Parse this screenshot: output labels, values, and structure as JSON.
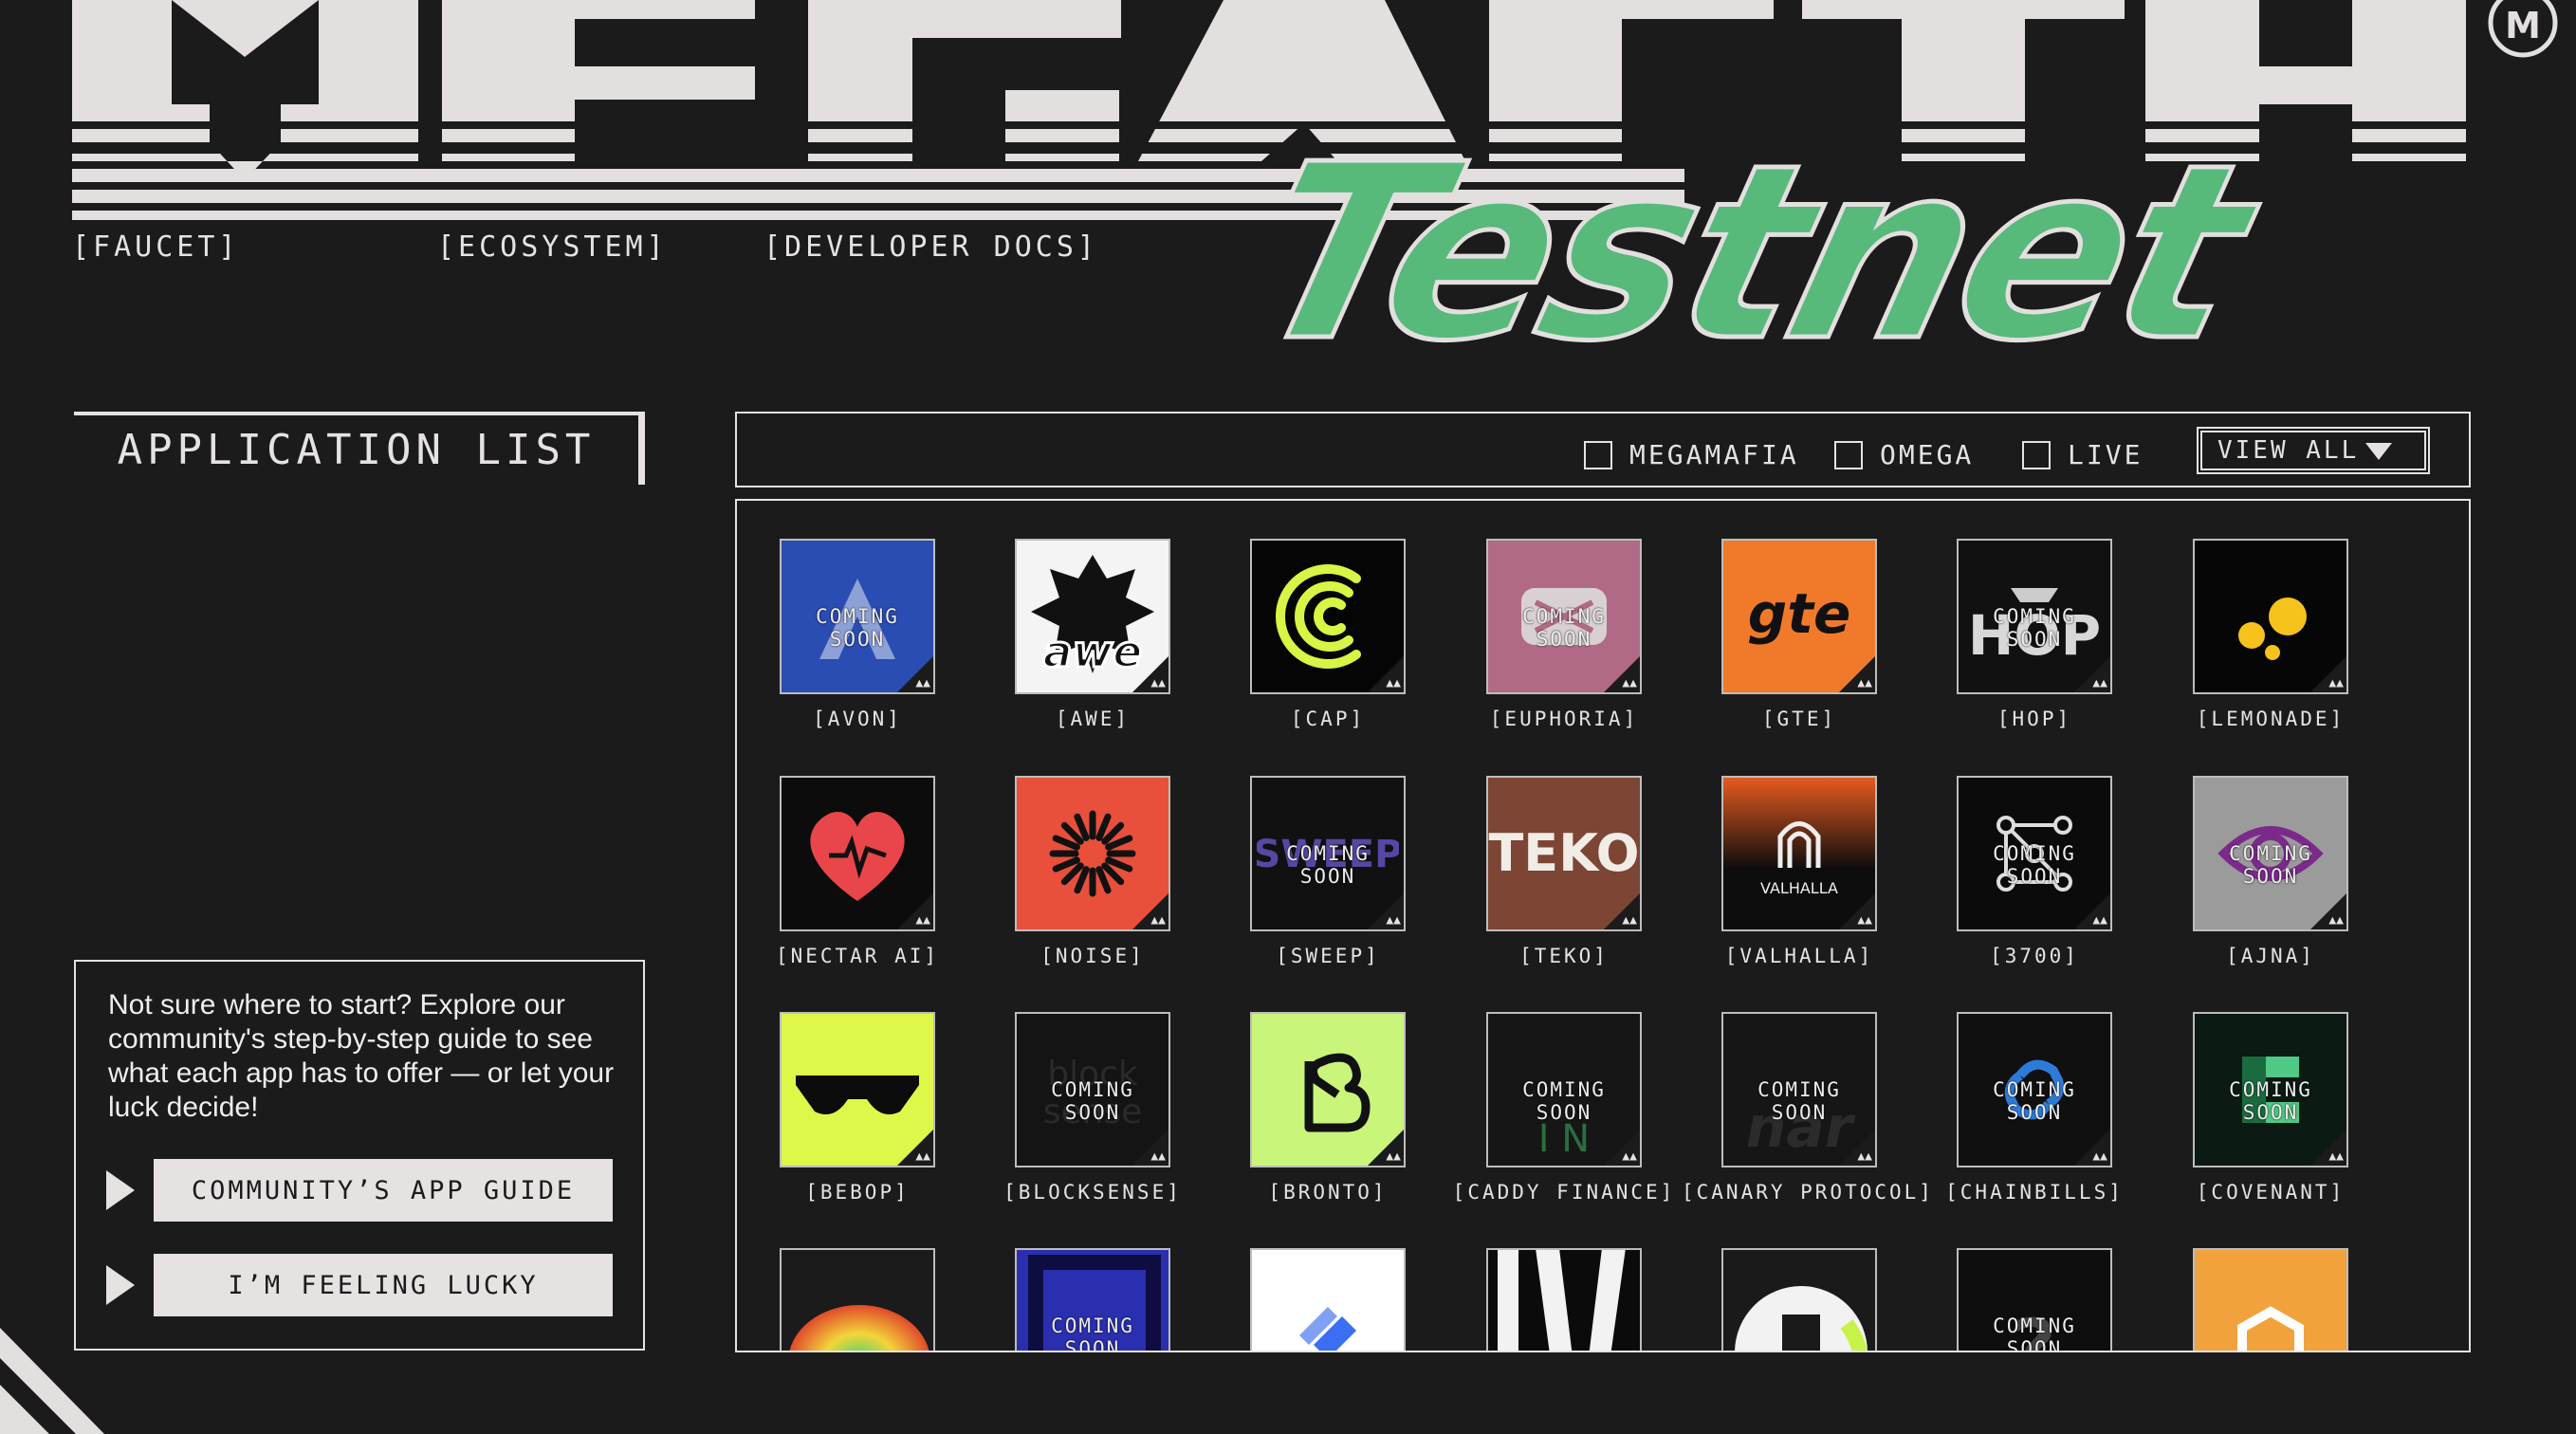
{
  "header": {
    "brand": "MEGAETH",
    "subtitle": "Testnet",
    "nav": {
      "faucet": "[FAUCET]",
      "ecosystem": "[ECOSYSTEM]",
      "docs": "[DEVELOPER DOCS]"
    },
    "badge_letter": "M"
  },
  "sidebar": {
    "tab_label": "APPLICATION LIST",
    "guide_text": "Not sure where to start? Explore our community's step-by-step guide to see what each app has to offer — or let your luck decide!",
    "guide_button": "COMMUNITY’S APP GUIDE",
    "lucky_button": "I’M FEELING LUCKY"
  },
  "filters": {
    "megamafia": "MEGAMAFIA",
    "omega": "OMEGA",
    "live": "LIVE",
    "view_select": "VIEW ALL"
  },
  "coming_soon": "COMING SOON",
  "apps": [
    {
      "label": "[AVON]",
      "soon": true,
      "bg": "#2a4db3",
      "icon": "avon-icon",
      "glyph": "A"
    },
    {
      "label": "[AWE]",
      "soon": false,
      "bg": "#f4f4f4",
      "icon": "awe-icon",
      "glyph": "awe"
    },
    {
      "label": "[CAP]",
      "soon": false,
      "bg": "#050505",
      "icon": "cap-icon",
      "glyph": "C"
    },
    {
      "label": "[EUPHORIA]",
      "soon": true,
      "bg": "#b06a86",
      "icon": "euphoria-icon",
      "glyph": ""
    },
    {
      "label": "[GTE]",
      "soon": false,
      "bg": "#f07a2a",
      "icon": "gte-icon",
      "glyph": "gte"
    },
    {
      "label": "[HOP]",
      "soon": true,
      "bg": "#111111",
      "icon": "hop-icon",
      "glyph": "HOP"
    },
    {
      "label": "[LEMONADE]",
      "soon": false,
      "bg": "#060606",
      "icon": "lemonade-icon",
      "glyph": ""
    },
    {
      "label": "[NECTAR AI]",
      "soon": false,
      "bg": "#0c0c0c",
      "icon": "nectar-heart-icon",
      "glyph": ""
    },
    {
      "label": "[NOISE]",
      "soon": false,
      "bg": "#e8503c",
      "icon": "noise-icon",
      "glyph": ""
    },
    {
      "label": "[SWEEP]",
      "soon": true,
      "bg": "#111111",
      "icon": "sweep-icon",
      "glyph": ""
    },
    {
      "label": "[TEKO]",
      "soon": false,
      "bg": "#7d4533",
      "icon": "teko-icon",
      "glyph": "TEKO"
    },
    {
      "label": "[VALHALLA]",
      "soon": false,
      "bg": "#1a0c08",
      "icon": "valhalla-icon",
      "glyph": "VALHALLA"
    },
    {
      "label": "[3700]",
      "soon": true,
      "bg": "#0b0b0b",
      "icon": "3700-icon",
      "glyph": ""
    },
    {
      "label": "[AJNA]",
      "soon": true,
      "bg": "#9b9b9b",
      "icon": "ajna-eye-icon",
      "glyph": ""
    },
    {
      "label": "[BEBOP]",
      "soon": false,
      "bg": "#dff748",
      "icon": "bebop-sunglasses-icon",
      "glyph": ""
    },
    {
      "label": "[BLOCKSENSE]",
      "soon": true,
      "bg": "#141414",
      "icon": "blocksense-icon",
      "glyph": ""
    },
    {
      "label": "[BRONTO]",
      "soon": false,
      "bg": "#c9f57a",
      "icon": "bronto-icon",
      "glyph": ""
    },
    {
      "label": "[CADDY FINANCE]",
      "soon": true,
      "bg": "#161616",
      "icon": "caddy-icon",
      "glyph": ""
    },
    {
      "label": "[CANARY PROTOCOL]",
      "soon": true,
      "bg": "#161616",
      "icon": "canary-icon",
      "glyph": ""
    },
    {
      "label": "[CHAINBILLS]",
      "soon": true,
      "bg": "#101010",
      "icon": "chainbills-icon",
      "glyph": ""
    },
    {
      "label": "[COVENANT]",
      "soon": true,
      "bg": "#0b1a12",
      "icon": "covenant-icon",
      "glyph": ""
    },
    {
      "label": "",
      "soon": false,
      "bg": "#e0572c",
      "icon": "gradient-ring-icon",
      "glyph": ""
    },
    {
      "label": "",
      "soon": true,
      "bg": "#2a2fb0",
      "icon": "blue-block-icon",
      "glyph": ""
    },
    {
      "label": "",
      "soon": false,
      "bg": "#ffffff",
      "icon": "blue-diamond-icon",
      "glyph": ""
    },
    {
      "label": "",
      "soon": false,
      "bg": "#0b0b0b",
      "icon": "stripes-icon",
      "glyph": ""
    },
    {
      "label": "",
      "soon": false,
      "bg": "#1a1a1a",
      "icon": "green-ring-icon",
      "glyph": ""
    },
    {
      "label": "",
      "soon": true,
      "bg": "#0e0e0e",
      "icon": "question-icon",
      "glyph": ""
    },
    {
      "label": "",
      "soon": false,
      "bg": "#f2a23c",
      "icon": "hexagon-icon",
      "glyph": ""
    }
  ]
}
